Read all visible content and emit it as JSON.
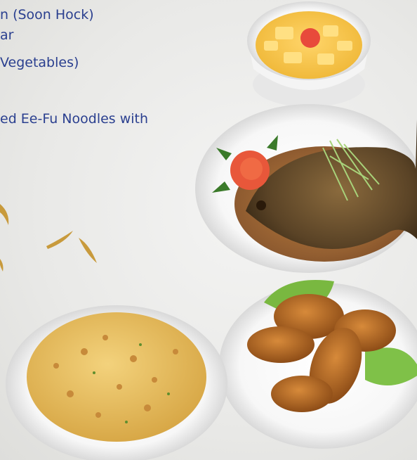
{
  "menu": {
    "items": [
      "n (Soon Hock)",
      "ar",
      "Vegetables)",
      "ed Ee-Fu Noodles with"
    ]
  },
  "colors": {
    "text": "#2a3f8f",
    "background": "#ececea"
  },
  "dishes": [
    "mango-sago-dessert",
    "steamed-soon-hock-fish",
    "fried-chicken-wings",
    "fried-rice"
  ]
}
